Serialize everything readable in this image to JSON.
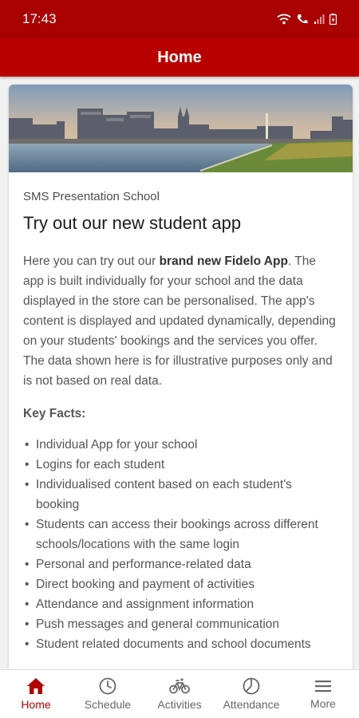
{
  "status_bar": {
    "time": "17:43"
  },
  "app_bar": {
    "title": "Home"
  },
  "card": {
    "subtitle": "SMS Presentation School",
    "title": "Try out our new student app",
    "intro_before": "Here you can try out our ",
    "intro_bold": "brand new Fidelo App",
    "intro_after": ". The app is built individually for your school and the data displayed in the store can be personalised. The app's content is displayed and updated dynamically, depending on your students' bookings and the services you offer. The data shown here is for illustrative purposes only and is not based on real data.",
    "key_facts_heading": "Key Facts:",
    "facts": [
      "Individual App for your school",
      "Logins for each student",
      "Individualised content based on each student's booking",
      "Students can access their bookings across different schools/locations with the same login",
      "Personal and performance-related data",
      "Direct booking and payment of activities",
      "Attendance and assignment information",
      "Push messages and general communication",
      "Student related documents and school documents"
    ]
  },
  "bottom_nav": {
    "items": [
      {
        "label": "Home",
        "icon": "home-icon",
        "active": true
      },
      {
        "label": "Schedule",
        "icon": "clock-icon",
        "active": false
      },
      {
        "label": "Activities",
        "icon": "bicycle-icon",
        "active": false
      },
      {
        "label": "Attendance",
        "icon": "pie-chart-icon",
        "active": false
      },
      {
        "label": "More",
        "icon": "menu-icon",
        "active": false
      }
    ]
  },
  "colors": {
    "primary": "#b80000",
    "status_bar": "#a90000",
    "active_nav": "#b00000"
  }
}
